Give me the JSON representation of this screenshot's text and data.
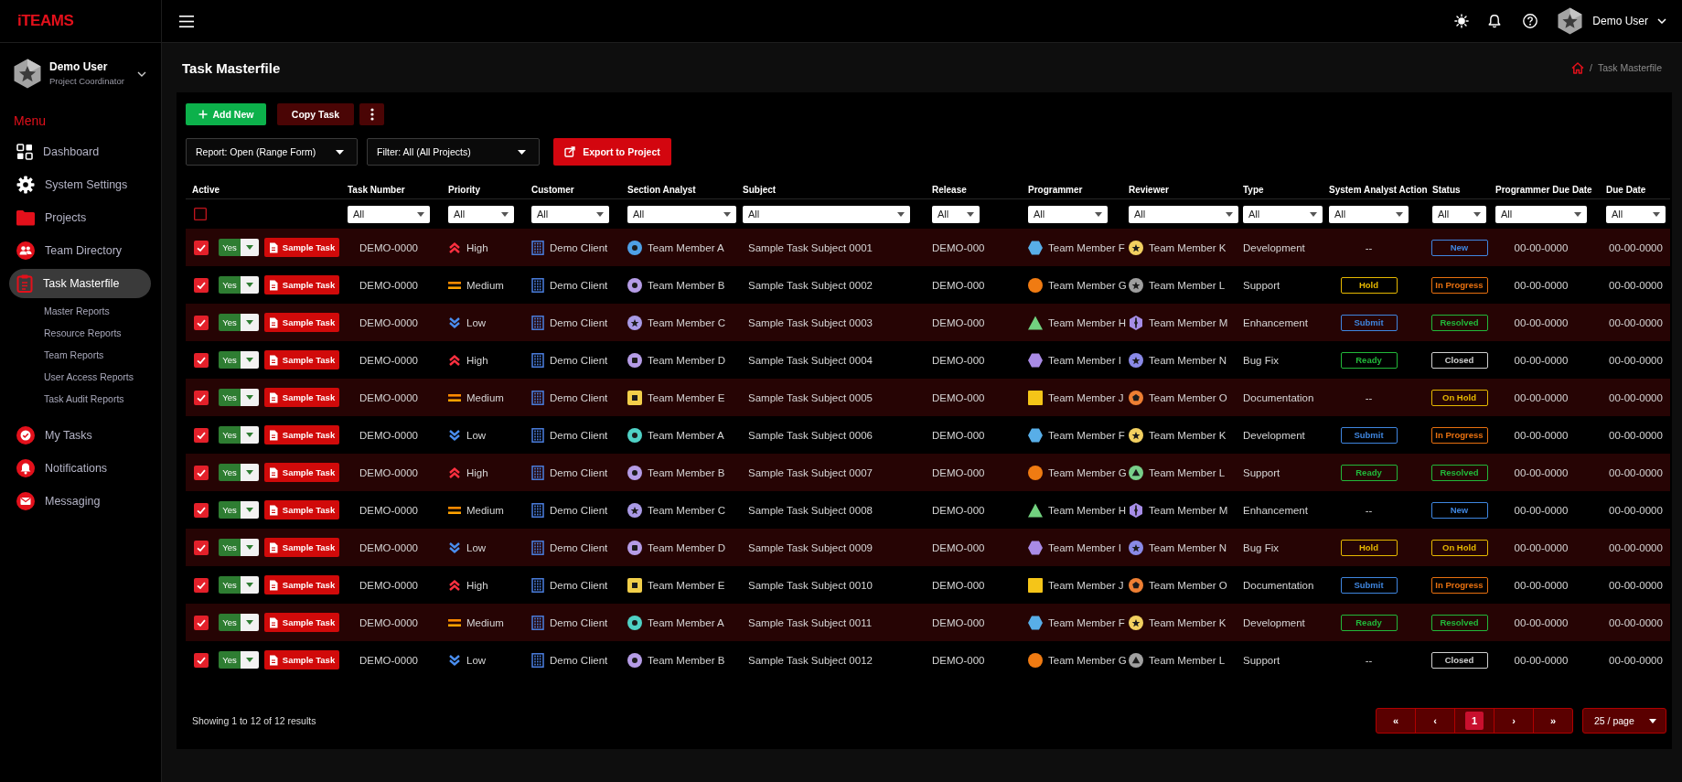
{
  "sidebar": {
    "logo": "iTEAMS",
    "user": {
      "name": "Demo User",
      "role": "Project Coordinator"
    },
    "menu_title": "Menu",
    "items": [
      {
        "label": "Dashboard",
        "kind": "grid",
        "selected": false
      },
      {
        "label": "System Settings",
        "kind": "gear",
        "selected": false
      },
      {
        "label": "Projects",
        "kind": "folder",
        "selected": false
      },
      {
        "label": "Team Directory",
        "kind": "people",
        "selected": false
      },
      {
        "label": "Task Masterfile",
        "kind": "clipboard",
        "selected": true,
        "children": [
          {
            "label": "Master Reports",
            "selected": false
          },
          {
            "label": "Resource Reports",
            "selected": false
          },
          {
            "label": "Team Reports",
            "selected": false
          },
          {
            "label": "User Access Reports",
            "selected": false
          },
          {
            "label": "Task Audit Reports",
            "selected": false
          }
        ]
      },
      {
        "label": "My Tasks",
        "kind": "check",
        "selected": false
      },
      {
        "label": "Notifications",
        "kind": "bell",
        "selected": false
      },
      {
        "label": "Messaging",
        "kind": "mail",
        "selected": false
      }
    ]
  },
  "topbar": {
    "user_name": "Demo User"
  },
  "page": {
    "title": "Task Masterfile",
    "breadcrumb": {
      "separator": "/",
      "current": "Task Masterfile"
    }
  },
  "toolbar": {
    "add_button": "Add New",
    "copy_button": "Copy Task",
    "report_dropdown": "Report: Open (Range Form)",
    "filter_dropdown": "Filter: All (All Projects)",
    "export_button": "Export to Project"
  },
  "table": {
    "columns": [
      {
        "label": "Active",
        "kind": "checkbox",
        "checked": false
      },
      {
        "label": "Task Number",
        "kind": "select",
        "filter": "All"
      },
      {
        "label": "Priority",
        "kind": "select",
        "filter": "All"
      },
      {
        "label": "Customer",
        "kind": "select",
        "filter": "All"
      },
      {
        "label": "Section Analyst",
        "kind": "select",
        "filter": "All"
      },
      {
        "label": "Subject",
        "kind": "select",
        "filter": "All"
      },
      {
        "label": "Release",
        "kind": "select",
        "filter": "All"
      },
      {
        "label": "Programmer",
        "kind": "select",
        "filter": "All"
      },
      {
        "label": "Reviewer",
        "kind": "select",
        "filter": "All"
      },
      {
        "label": "Type",
        "kind": "select",
        "filter": "All"
      },
      {
        "label": "System Analyst Action",
        "kind": "select",
        "filter": "All"
      },
      {
        "label": "Status",
        "kind": "select",
        "filter": "All"
      },
      {
        "label": "Programmer Due Date",
        "kind": "select",
        "filter": "All"
      },
      {
        "label": "Due Date",
        "kind": "select",
        "filter": "All"
      }
    ],
    "rows": [
      {
        "active": true,
        "enabled": "Yes",
        "task_button": "Sample Task",
        "number": "DEMO-0000",
        "priority": {
          "label": "High",
          "kind": "up"
        },
        "customer": "Demo Client",
        "analyst": {
          "name": "Team Member A",
          "kind": "ring",
          "color": "#4ea0e6"
        },
        "subject": "Sample Task Subject 0001",
        "release": "DEMO-000",
        "programmer": {
          "name": "Team Member F",
          "kind": "hexagon",
          "color": "#58aee8"
        },
        "reviewer": {
          "name": "Team Member K",
          "kind": "star-disc",
          "color": "#f2d060"
        },
        "type": "Development",
        "sa_action": {
          "kind": "plain",
          "label": "--"
        },
        "status": {
          "label": "New",
          "color": "#3f86e0"
        },
        "programmer_due": "00-00-0000",
        "due": "00-00-0000"
      },
      {
        "active": true,
        "enabled": "Yes",
        "task_button": "Sample Task",
        "number": "DEMO-0000",
        "priority": {
          "label": "Medium",
          "kind": "equal"
        },
        "customer": "Demo Client",
        "analyst": {
          "name": "Team Member B",
          "kind": "ring",
          "color": "#b59ce6"
        },
        "subject": "Sample Task Subject 0002",
        "release": "DEMO-000",
        "programmer": {
          "name": "Team Member G",
          "kind": "circle",
          "color": "#f07b12"
        },
        "reviewer": {
          "name": "Team Member L",
          "kind": "star-disc",
          "color": "#9e9e9e"
        },
        "type": "Support",
        "sa_action": {
          "kind": "badge",
          "label": "Hold",
          "color": "#e6b800"
        },
        "status": {
          "label": "In Progress",
          "color": "#e8700f"
        },
        "programmer_due": "00-00-0000",
        "due": "00-00-0000"
      },
      {
        "active": true,
        "enabled": "Yes",
        "task_button": "Sample Task",
        "number": "DEMO-0000",
        "priority": {
          "label": "Low",
          "kind": "down"
        },
        "customer": "Demo Client",
        "analyst": {
          "name": "Team Member C",
          "kind": "star-disc",
          "color": "#a99ae6"
        },
        "subject": "Sample Task Subject 0003",
        "release": "DEMO-000",
        "programmer": {
          "name": "Team Member H",
          "kind": "triangle",
          "color": "#72d17f"
        },
        "reviewer": {
          "name": "Team Member M",
          "kind": "hex-line",
          "color": "#a68de8"
        },
        "type": "Enhancement",
        "sa_action": {
          "kind": "badge",
          "label": "Submit",
          "color": "#3f86e0"
        },
        "status": {
          "label": "Resolved",
          "color": "#22b83a"
        },
        "programmer_due": "00-00-0000",
        "due": "00-00-0000"
      },
      {
        "active": true,
        "enabled": "Yes",
        "task_button": "Sample Task",
        "number": "DEMO-0000",
        "priority": {
          "label": "High",
          "kind": "up"
        },
        "customer": "Demo Client",
        "analyst": {
          "name": "Team Member D",
          "kind": "square-disc",
          "color": "#b59ce6"
        },
        "subject": "Sample Task Subject 0004",
        "release": "DEMO-000",
        "programmer": {
          "name": "Team Member I",
          "kind": "hexagon",
          "color": "#a98be6"
        },
        "reviewer": {
          "name": "Team Member N",
          "kind": "star-disc",
          "color": "#8a8ae8"
        },
        "type": "Bug Fix",
        "sa_action": {
          "kind": "badge",
          "label": "Ready",
          "color": "#22b83a"
        },
        "status": {
          "label": "Closed",
          "color": "#d0d0d0"
        },
        "programmer_due": "00-00-0000",
        "due": "00-00-0000"
      },
      {
        "active": true,
        "enabled": "Yes",
        "task_button": "Sample Task",
        "number": "DEMO-0000",
        "priority": {
          "label": "Medium",
          "kind": "equal"
        },
        "customer": "Demo Client",
        "analyst": {
          "name": "Team Member E",
          "kind": "square-dot",
          "color": "#f2cf4a"
        },
        "subject": "Sample Task Subject 0005",
        "release": "DEMO-000",
        "programmer": {
          "name": "Team Member J",
          "kind": "square",
          "color": "#f5c518"
        },
        "reviewer": {
          "name": "Team Member O",
          "kind": "pentagon-ring",
          "color": "#ee7f33"
        },
        "type": "Documentation",
        "sa_action": {
          "kind": "plain",
          "label": "--"
        },
        "status": {
          "label": "On Hold",
          "color": "#e6b800"
        },
        "programmer_due": "00-00-0000",
        "due": "00-00-0000"
      },
      {
        "active": true,
        "enabled": "Yes",
        "task_button": "Sample Task",
        "number": "DEMO-0000",
        "priority": {
          "label": "Low",
          "kind": "down"
        },
        "customer": "Demo Client",
        "analyst": {
          "name": "Team Member A",
          "kind": "ring",
          "color": "#4fd1c5"
        },
        "subject": "Sample Task Subject 0006",
        "release": "DEMO-000",
        "programmer": {
          "name": "Team Member F",
          "kind": "hexagon",
          "color": "#58aee8"
        },
        "reviewer": {
          "name": "Team Member K",
          "kind": "star-disc",
          "color": "#f2d060"
        },
        "type": "Development",
        "sa_action": {
          "kind": "badge",
          "label": "Submit",
          "color": "#3f86e0"
        },
        "status": {
          "label": "In Progress",
          "color": "#e8700f"
        },
        "programmer_due": "00-00-0000",
        "due": "00-00-0000"
      },
      {
        "active": true,
        "enabled": "Yes",
        "task_button": "Sample Task",
        "number": "DEMO-0000",
        "priority": {
          "label": "High",
          "kind": "up"
        },
        "customer": "Demo Client",
        "analyst": {
          "name": "Team Member B",
          "kind": "ring",
          "color": "#b59ce6"
        },
        "subject": "Sample Task Subject 0007",
        "release": "DEMO-000",
        "programmer": {
          "name": "Team Member G",
          "kind": "circle",
          "color": "#f07b12"
        },
        "reviewer": {
          "name": "Team Member L",
          "kind": "triangle-disc",
          "color": "#78cf8a"
        },
        "type": "Support",
        "sa_action": {
          "kind": "badge",
          "label": "Ready",
          "color": "#22b83a"
        },
        "status": {
          "label": "Resolved",
          "color": "#22b83a"
        },
        "programmer_due": "00-00-0000",
        "due": "00-00-0000"
      },
      {
        "active": true,
        "enabled": "Yes",
        "task_button": "Sample Task",
        "number": "DEMO-0000",
        "priority": {
          "label": "Medium",
          "kind": "equal"
        },
        "customer": "Demo Client",
        "analyst": {
          "name": "Team Member C",
          "kind": "star-disc",
          "color": "#a99ae6"
        },
        "subject": "Sample Task Subject 0008",
        "release": "DEMO-000",
        "programmer": {
          "name": "Team Member H",
          "kind": "triangle",
          "color": "#72d17f"
        },
        "reviewer": {
          "name": "Team Member M",
          "kind": "hex-line",
          "color": "#a68de8"
        },
        "type": "Enhancement",
        "sa_action": {
          "kind": "plain",
          "label": "--"
        },
        "status": {
          "label": "New",
          "color": "#3f86e0"
        },
        "programmer_due": "00-00-0000",
        "due": "00-00-0000"
      },
      {
        "active": true,
        "enabled": "Yes",
        "task_button": "Sample Task",
        "number": "DEMO-0000",
        "priority": {
          "label": "Low",
          "kind": "down"
        },
        "customer": "Demo Client",
        "analyst": {
          "name": "Team Member D",
          "kind": "square-disc",
          "color": "#b59ce6"
        },
        "subject": "Sample Task Subject 0009",
        "release": "DEMO-000",
        "programmer": {
          "name": "Team Member I",
          "kind": "hexagon",
          "color": "#a98be6"
        },
        "reviewer": {
          "name": "Team Member N",
          "kind": "star-disc",
          "color": "#8a8ae8"
        },
        "type": "Bug Fix",
        "sa_action": {
          "kind": "badge",
          "label": "Hold",
          "color": "#e6b800"
        },
        "status": {
          "label": "On Hold",
          "color": "#e6b800"
        },
        "programmer_due": "00-00-0000",
        "due": "00-00-0000"
      },
      {
        "active": true,
        "enabled": "Yes",
        "task_button": "Sample Task",
        "number": "DEMO-0000",
        "priority": {
          "label": "High",
          "kind": "up"
        },
        "customer": "Demo Client",
        "analyst": {
          "name": "Team Member E",
          "kind": "square-dot",
          "color": "#f2cf4a"
        },
        "subject": "Sample Task Subject 0010",
        "release": "DEMO-000",
        "programmer": {
          "name": "Team Member J",
          "kind": "square",
          "color": "#f5c518"
        },
        "reviewer": {
          "name": "Team Member O",
          "kind": "pentagon-ring",
          "color": "#ee7f33"
        },
        "type": "Documentation",
        "sa_action": {
          "kind": "badge",
          "label": "Submit",
          "color": "#3f86e0"
        },
        "status": {
          "label": "In Progress",
          "color": "#e8700f"
        },
        "programmer_due": "00-00-0000",
        "due": "00-00-0000"
      },
      {
        "active": true,
        "enabled": "Yes",
        "task_button": "Sample Task",
        "number": "DEMO-0000",
        "priority": {
          "label": "Medium",
          "kind": "equal"
        },
        "customer": "Demo Client",
        "analyst": {
          "name": "Team Member A",
          "kind": "ring",
          "color": "#4fd1c5"
        },
        "subject": "Sample Task Subject 0011",
        "release": "DEMO-000",
        "programmer": {
          "name": "Team Member F",
          "kind": "hexagon",
          "color": "#58aee8"
        },
        "reviewer": {
          "name": "Team Member K",
          "kind": "star-disc",
          "color": "#f2d060"
        },
        "type": "Development",
        "sa_action": {
          "kind": "badge",
          "label": "Ready",
          "color": "#22b83a"
        },
        "status": {
          "label": "Resolved",
          "color": "#22b83a"
        },
        "programmer_due": "00-00-0000",
        "due": "00-00-0000"
      },
      {
        "active": true,
        "enabled": "Yes",
        "task_button": "Sample Task",
        "number": "DEMO-0000",
        "priority": {
          "label": "Low",
          "kind": "down"
        },
        "customer": "Demo Client",
        "analyst": {
          "name": "Team Member B",
          "kind": "ring",
          "color": "#b59ce6"
        },
        "subject": "Sample Task Subject 0012",
        "release": "DEMO-000",
        "programmer": {
          "name": "Team Member G",
          "kind": "circle",
          "color": "#f07b12"
        },
        "reviewer": {
          "name": "Team Member L",
          "kind": "triangle-disc",
          "color": "#a0a0a0"
        },
        "type": "Support",
        "sa_action": {
          "kind": "plain",
          "label": "--"
        },
        "status": {
          "label": "Closed",
          "color": "#d0d0d0"
        },
        "programmer_due": "00-00-0000",
        "due": "00-00-0000"
      }
    ]
  },
  "footer": {
    "summary": "Showing 1 to 12 of 12 results"
  },
  "pagination": {
    "first": "«",
    "prev": "‹",
    "pages": [
      {
        "label": "1",
        "selected": true
      }
    ],
    "next": "›",
    "last": "»",
    "page_size": "25 / page"
  }
}
